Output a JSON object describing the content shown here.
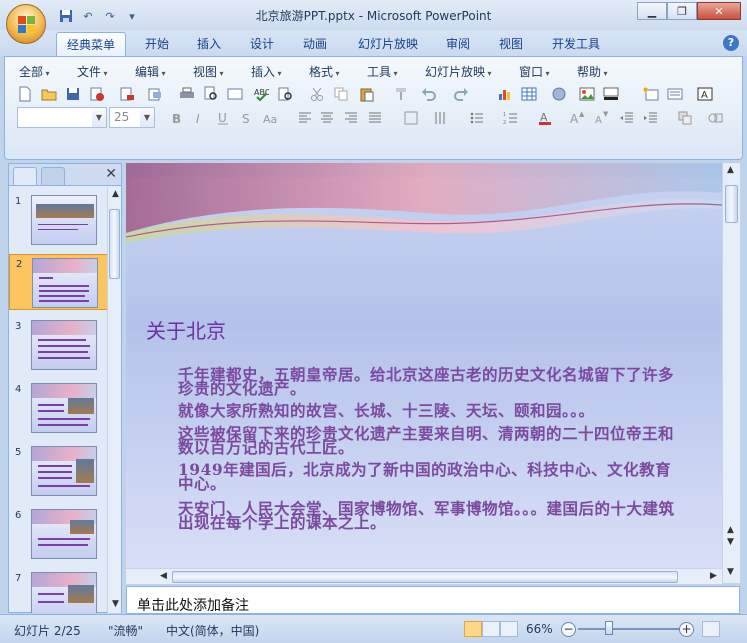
{
  "window": {
    "title": "北京旅游PPT.pptx - Microsoft PowerPoint",
    "minimize": "▁",
    "restore": "❐",
    "close": "✕"
  },
  "ribbon_tabs": [
    "经典菜单",
    "开始",
    "插入",
    "设计",
    "动画",
    "幻灯片放映",
    "审阅",
    "视图",
    "开发工具"
  ],
  "active_tab": "经典菜单",
  "menus": [
    "全部",
    "文件",
    "编辑",
    "视图",
    "插入",
    "格式",
    "工具",
    "幻灯片放映",
    "窗口",
    "帮助"
  ],
  "font": {
    "name_value": "",
    "size_value": "25"
  },
  "slide_panel": {
    "tab_close": "✕",
    "slides": [
      {
        "number": "1"
      },
      {
        "number": "2",
        "selected": true
      },
      {
        "number": "3"
      },
      {
        "number": "4"
      },
      {
        "number": "5"
      },
      {
        "number": "6"
      },
      {
        "number": "7"
      }
    ]
  },
  "slide": {
    "title": "关于北京",
    "paragraphs": [
      "千年建都史，五朝皇帝居。给北京这座古老的历史文化名城留下了许多珍贵的文化遗产。",
      "就像大家所熟知的故宫、长城、十三陵、天坛、颐和园。。。",
      "这些被保留下来的珍贵文化遗产主要来自明、清两朝的二十四位帝王和数以百万记的古代工匠。",
      "1949年建国后，北京成为了新中国的政治中心、科技中心、文化教育中心。",
      "天安门、人民大会堂、国家博物馆、军事博物馆。。。建国后的十大建筑出现在每个学上的课本之上。"
    ]
  },
  "notes": {
    "placeholder": "单击此处添加备注"
  },
  "status": {
    "slide_counter": "幻灯片 2/25",
    "theme": "\"流畅\"",
    "language": "中文(简体，中国)",
    "zoom": "66%",
    "zoom_out": "−",
    "zoom_in": "+"
  },
  "colors": {
    "title": "#7030a0",
    "body": "#7b4a9e",
    "accent": "#fcc55f"
  }
}
